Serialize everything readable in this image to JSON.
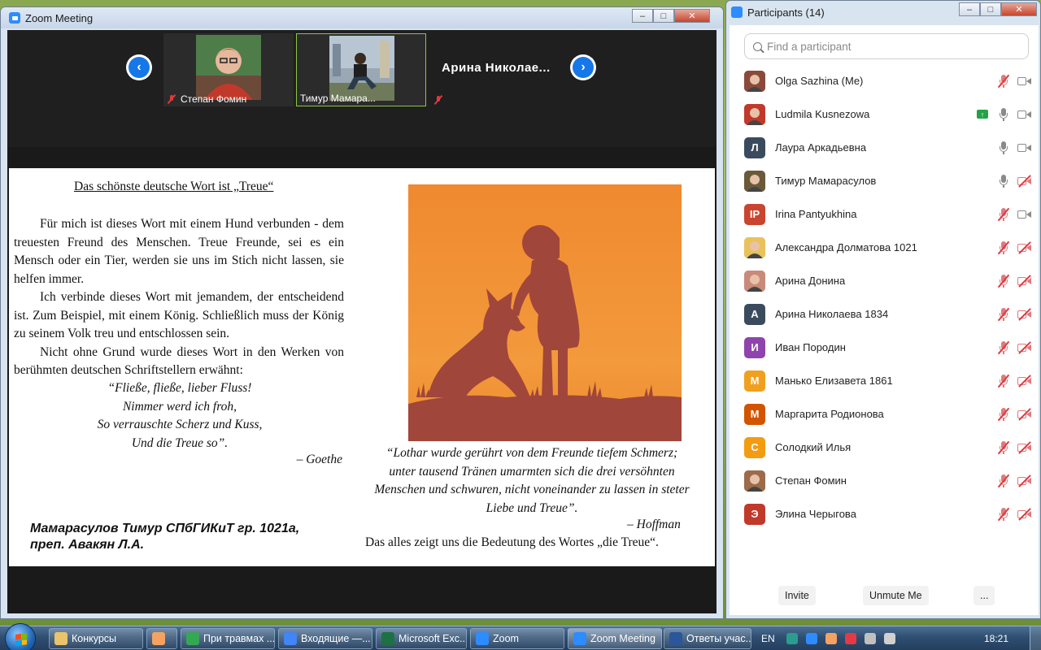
{
  "zoom_window": {
    "title": "Zoom Meeting",
    "video_tiles": [
      {
        "name": "Степан Фомин",
        "muted": true
      },
      {
        "name": "Тимур Мамара...",
        "muted": false
      },
      {
        "name": "Арина  Николае...",
        "muted": true
      }
    ],
    "slide": {
      "title": "Das schönste deutsche Wort ist „Treue“",
      "paragraphs": [
        "Für mich ist dieses Wort mit einem Hund verbunden - dem treuesten Freund des Menschen. Treue Freunde, sei es ein Mensch oder ein Tier, werden sie uns im Stich nicht lassen, sie helfen immer.",
        "Ich verbinde dieses Wort mit jemandem, der entscheidend ist. Zum Beispiel, mit einem König. Schließlich muss der König zu seinem Volk treu und entschlossen sein.",
        "Nicht ohne Grund wurde dieses Wort in den Werken von berühmten deutschen Schriftstellern erwähnt:"
      ],
      "poem": [
        "“Fließe, fließe, lieber Fluss!",
        "Nimmer werd ich froh,",
        "So verrauschte Scherz und Kuss,",
        "Und die Treue so”."
      ],
      "poem_author": "–   Goethe",
      "quote": "“Lothar wurde gerührt von dem Freunde tiefem Schmerz; unter tausend Tränen umarmten sich die drei versöhnten Menschen und schwuren, nicht voneinander zu lassen in steter Liebe und Treue”.",
      "quote_author": "–   Hoffman",
      "author_line1": "Мамарасулов Тимур СПбГИКиТ гр. 1021а,",
      "author_line2": "преп. Авакян Л.А.",
      "conclusion": "Das alles zeigt uns die Bedeutung des Wortes „die Treue“."
    }
  },
  "participants_window": {
    "title": "Participants (14)",
    "search_placeholder": "Find a participant",
    "participants": [
      {
        "name": "Olga Sazhina (Me)",
        "avatar": "photo",
        "color": "#8a4a3a",
        "mic": "muted",
        "cam": "on"
      },
      {
        "name": "Ludmila Kusnezowa",
        "avatar": "photo",
        "color": "#c0392b",
        "mic": "on",
        "cam": "on",
        "sharing": true
      },
      {
        "name": "Лаура Аркадьевна",
        "avatar": "Л",
        "color": "#3b4b5e",
        "mic": "on",
        "cam": "on"
      },
      {
        "name": "Тимур Мамарасулов",
        "avatar": "photo",
        "color": "#6b5a3a",
        "mic": "on",
        "cam": "off"
      },
      {
        "name": "Irina Pantyukhina",
        "avatar": "IP",
        "color": "#c9452f",
        "mic": "muted",
        "cam": "on"
      },
      {
        "name": "Александра Долматова 1021",
        "avatar": "photo",
        "color": "#e8c25a",
        "mic": "muted",
        "cam": "off"
      },
      {
        "name": "Арина Донина",
        "avatar": "photo",
        "color": "#c98a7a",
        "mic": "muted",
        "cam": "off"
      },
      {
        "name": "Арина Николаева 1834",
        "avatar": "А",
        "color": "#3b4b5e",
        "mic": "muted",
        "cam": "off"
      },
      {
        "name": "Иван Породин",
        "avatar": "И",
        "color": "#8e44ad",
        "mic": "muted",
        "cam": "off"
      },
      {
        "name": "Манько Елизавета 1861",
        "avatar": "М",
        "color": "#f0a020",
        "mic": "muted",
        "cam": "off"
      },
      {
        "name": "Маргарита Родионова",
        "avatar": "М",
        "color": "#d35400",
        "mic": "muted",
        "cam": "off"
      },
      {
        "name": "Солодкий Илья",
        "avatar": "С",
        "color": "#f39c12",
        "mic": "muted",
        "cam": "off"
      },
      {
        "name": "Степан Фомин",
        "avatar": "photo",
        "color": "#9c6b4a",
        "mic": "muted",
        "cam": "off"
      },
      {
        "name": "Элина Черыгова",
        "avatar": "Э",
        "color": "#c0392b",
        "mic": "muted",
        "cam": "off"
      }
    ],
    "buttons": {
      "invite": "Invite",
      "unmute": "Unmute Me",
      "more": "..."
    }
  },
  "taskbar": {
    "items": [
      {
        "label": "Конкурсы",
        "color": "#e9c46a"
      },
      {
        "label": "",
        "color": "#f4a261"
      },
      {
        "label": "При травмах ...",
        "color": "#34a853"
      },
      {
        "label": "Входящие —...",
        "color": "#4285f4"
      },
      {
        "label": "Microsoft Exc...",
        "color": "#1e7145"
      },
      {
        "label": "Zoom",
        "color": "#2d8cff"
      },
      {
        "label": "Zoom Meeting",
        "color": "#2d8cff"
      },
      {
        "label": "Ответы учас...",
        "color": "#2b579a"
      }
    ],
    "language": "EN",
    "time": "18:21"
  }
}
